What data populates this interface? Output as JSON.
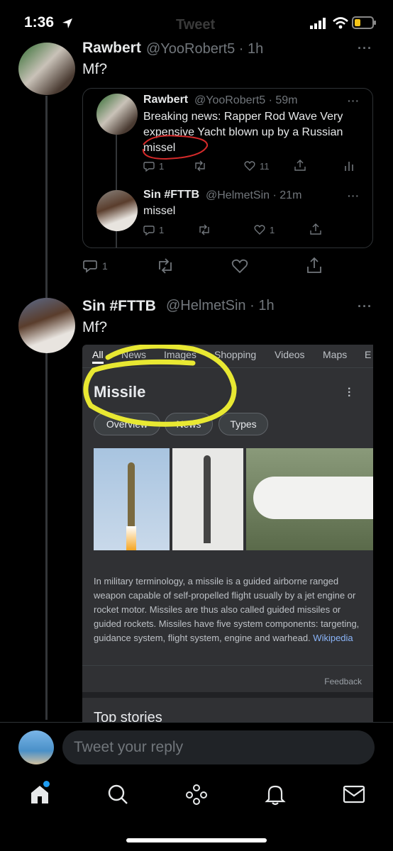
{
  "status_bar": {
    "time": "1:36",
    "page_title": "Tweet"
  },
  "tweet1": {
    "name": "Rawbert",
    "handle": "@YooRobert5 · 1h",
    "text": "Mf?",
    "quote": {
      "name": "Rawbert",
      "handle": "@YooRobert5 · 59m",
      "text_line1": "Breaking news: Rapper Rod Wave Very",
      "text_line2": "expensive Yacht blown up by a Russian",
      "text_line3": "missel",
      "reply_count": "1",
      "like_count": "11"
    },
    "reply": {
      "name": "Sin #FTTB",
      "handle": "@HelmetSin · 21m",
      "text": "missel",
      "reply_count": "1",
      "like_count": "1"
    },
    "reply_count": "1"
  },
  "tweet2": {
    "name": "Sin #FTTB",
    "handle": "@HelmetSin · 1h",
    "text": "Mf?"
  },
  "google": {
    "tabs": [
      "All",
      "News",
      "Images",
      "Shopping",
      "Videos",
      "Maps",
      "E"
    ],
    "title": "Missile",
    "chips": [
      "Overview",
      "News",
      "Types"
    ],
    "description": "In military terminology, a missile is a guided airborne ranged weapon capable of self-propelled flight usually by a jet engine or rocket motor. Missiles are thus also called guided missiles or guided rockets. Missiles have five system components: targeting, guidance system, flight system, engine and warhead.",
    "source": "Wikipedia",
    "feedback": "Feedback",
    "top_stories": "Top stories"
  },
  "reply_box": {
    "placeholder": "Tweet your reply"
  },
  "colors": {
    "annotation_red": "#d42a2a",
    "annotation_yellow": "#e8e832",
    "notification_dot": "#1d9bf0"
  },
  "nav_icons": [
    "home-icon",
    "search-icon",
    "spaces-icon",
    "notifications-icon",
    "messages-icon"
  ]
}
